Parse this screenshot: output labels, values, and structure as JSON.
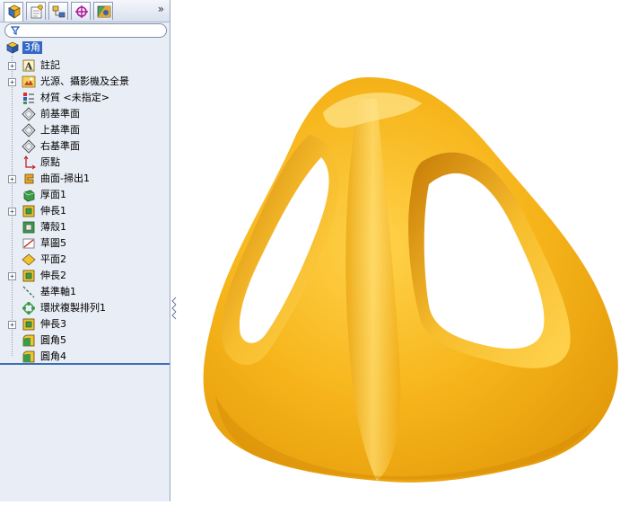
{
  "panel": {
    "tabs": [
      {
        "name": "feature-manager"
      },
      {
        "name": "property-manager"
      },
      {
        "name": "configuration-manager"
      },
      {
        "name": "dimxpert-manager"
      },
      {
        "name": "display-manager"
      }
    ],
    "more_glyph": "»",
    "filter": {
      "value": "",
      "icon": "filter-icon"
    }
  },
  "tree": {
    "root": "3角",
    "items": [
      {
        "label": "註記",
        "icon": "annotations-icon",
        "expandable": true
      },
      {
        "label": "光源、攝影機及全景",
        "icon": "lights-cameras-icon",
        "expandable": true
      },
      {
        "label": "材質 <未指定>",
        "icon": "material-icon",
        "expandable": false
      },
      {
        "label": "前基準面",
        "icon": "plane-icon",
        "expandable": false
      },
      {
        "label": "上基準面",
        "icon": "plane-icon",
        "expandable": false
      },
      {
        "label": "右基準面",
        "icon": "plane-icon",
        "expandable": false
      },
      {
        "label": "原點",
        "icon": "origin-icon",
        "expandable": false
      },
      {
        "label": "曲面-掃出1",
        "icon": "surface-sweep-icon",
        "expandable": true
      },
      {
        "label": "厚面1",
        "icon": "thicken-icon",
        "expandable": false
      },
      {
        "label": "伸長1",
        "icon": "extrude-icon",
        "expandable": true
      },
      {
        "label": "薄殼1",
        "icon": "shell-icon",
        "expandable": false
      },
      {
        "label": "草圖5",
        "icon": "sketch-icon",
        "expandable": false
      },
      {
        "label": "平面2",
        "icon": "plane2-icon",
        "expandable": false
      },
      {
        "label": "伸長2",
        "icon": "extrude-icon",
        "expandable": true
      },
      {
        "label": "基準軸1",
        "icon": "axis-icon",
        "expandable": false
      },
      {
        "label": "環狀複製排列1",
        "icon": "circular-pattern-icon",
        "expandable": false
      },
      {
        "label": "伸長3",
        "icon": "extrude-icon",
        "expandable": true
      },
      {
        "label": "圓角5",
        "icon": "fillet-icon",
        "expandable": false
      },
      {
        "label": "圓角4",
        "icon": "fillet-icon",
        "expandable": false
      }
    ]
  },
  "viewport": {
    "model_color": "#f4b31c",
    "model_shadow": "#d98a05",
    "model_highlight": "#ffe38a"
  }
}
